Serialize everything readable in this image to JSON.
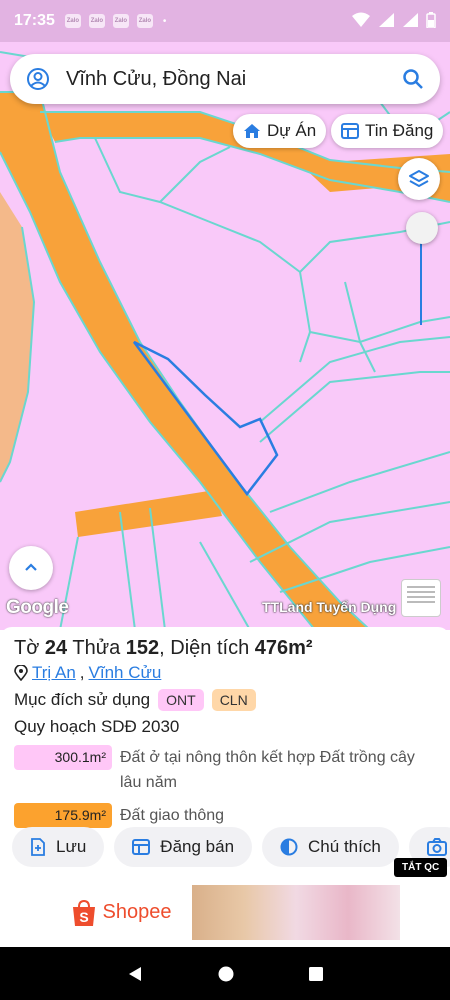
{
  "status_bar": {
    "time": "17:35",
    "app_icons": [
      "Zalo",
      "Zalo",
      "Zalo",
      "Zalo"
    ],
    "extra": "•"
  },
  "search": {
    "text": "Vĩnh Cửu, Đồng Nai"
  },
  "chips": {
    "du_an": "Dự Án",
    "tin_dang": "Tin Đăng"
  },
  "map": {
    "google_label": "Google",
    "tt_label": "TTLand Tuyển Dụng"
  },
  "parcel": {
    "to_label": "Tờ",
    "to_value": "24",
    "thua_label": "Thửa",
    "thua_value": "152",
    "area_label": ", Diện tích",
    "area_value": "476m²",
    "location_1": "Trị An",
    "location_sep": ",",
    "location_2": "Vĩnh Cửu",
    "purpose_label": "Mục đích sử dụng",
    "badges": [
      "ONT",
      "CLN"
    ],
    "plan_label": "Quy hoạch SDĐ 2030",
    "land_uses": [
      {
        "area": "300.1m²",
        "desc": "Đất ở tại nông thôn kết hợp Đất trồng cây lâu năm",
        "color": "#ffc7f7"
      },
      {
        "area": "175.9m²",
        "desc": "Đất giao thông",
        "color": "#fca22e"
      }
    ]
  },
  "actions": {
    "save": "Lưu",
    "post": "Đăng bán",
    "legend": "Chú thích"
  },
  "ad": {
    "close_label": "TẮT QC",
    "brand": "Shopee"
  },
  "colors": {
    "map_pink": "#f9c9f9",
    "road_orange": "#f8a23a",
    "boundary_cyan": "#6ad7cf",
    "accent_blue": "#2a7de1",
    "status_bar": "#e2b3e2"
  }
}
